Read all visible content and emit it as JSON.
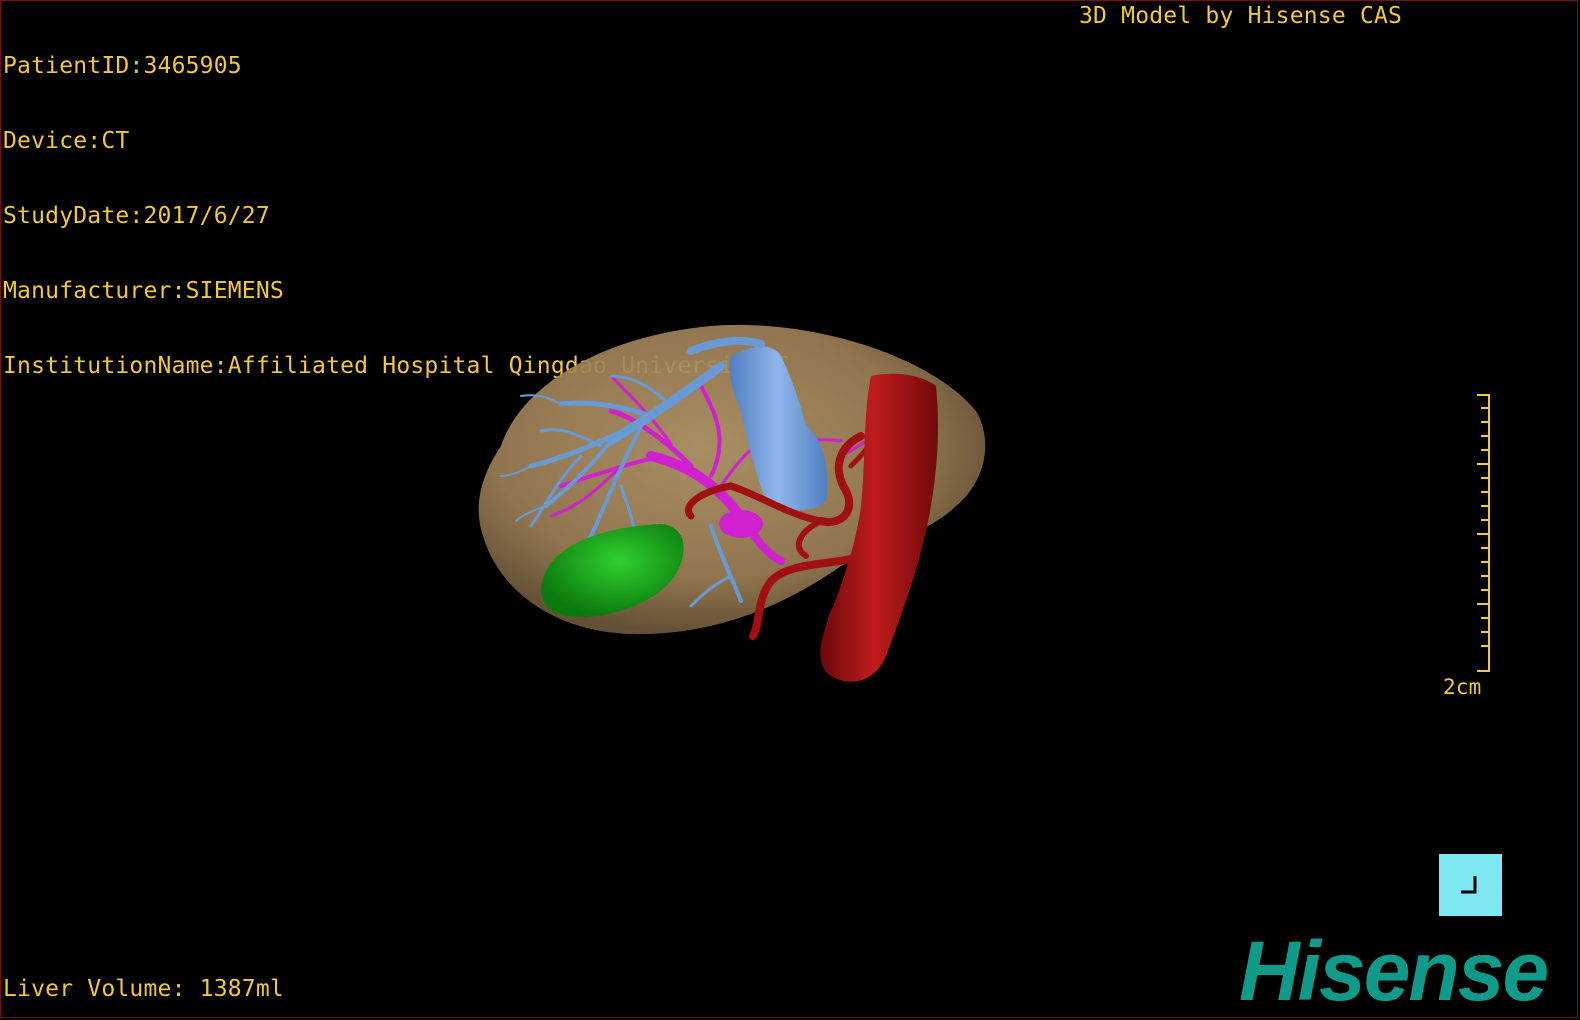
{
  "patient_info": {
    "patient_id": "PatientID:3465905",
    "device": "Device:CT",
    "study_date": "StudyDate:2017/6/27",
    "manufacturer": "Manufacturer:SIEMENS",
    "institution": "InstitutionName:Affiliated Hospital Qingdao University-C"
  },
  "model_credit": "3D Model by Hisense CAS",
  "scale_label": "2cm",
  "liver_volume": "Liver Volume: 1387ml",
  "brand": "Hisense",
  "colors": {
    "overlay_text": "#f0c840",
    "liver": "#a98a5e",
    "hepatic_vein": "#6a9ad6",
    "portal_vein": "#d020d0",
    "artery": "#a01010",
    "gallbladder": "#1aa01a",
    "corner_button": "#7ee8f2",
    "brand": "#109a8a"
  },
  "icons": {
    "corner_button": "corner-bracket-icon"
  }
}
